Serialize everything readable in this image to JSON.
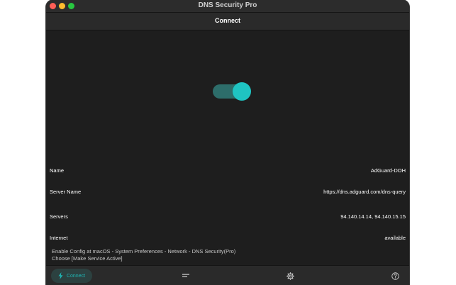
{
  "window": {
    "title": "DNS Security Pro"
  },
  "navbar": {
    "title": "Connect"
  },
  "connection": {
    "enabled": true,
    "toggle_color": "#1fc4c2"
  },
  "info": {
    "name": {
      "label": "Name",
      "value": "AdGuard-DOH"
    },
    "server_name": {
      "label": "Server Name",
      "value": "https://dns.adguard.com/dns-query"
    },
    "servers": {
      "label": "Servers",
      "value": "94.140.14.14, 94.140.15.15"
    },
    "internet": {
      "label": "Internet",
      "value": "available"
    }
  },
  "note": {
    "line1": "Enable Config at macOS - System Preferences - Network - DNS Security(Pro)",
    "line2": "Choose [Make Service Active]"
  },
  "tabbar": {
    "connect_label": "Connect",
    "connect_icon": "bolt-icon",
    "list_icon": "list-icon",
    "settings_icon": "gear-icon",
    "help_icon": "question-icon",
    "accent": "#1fb5b3"
  }
}
